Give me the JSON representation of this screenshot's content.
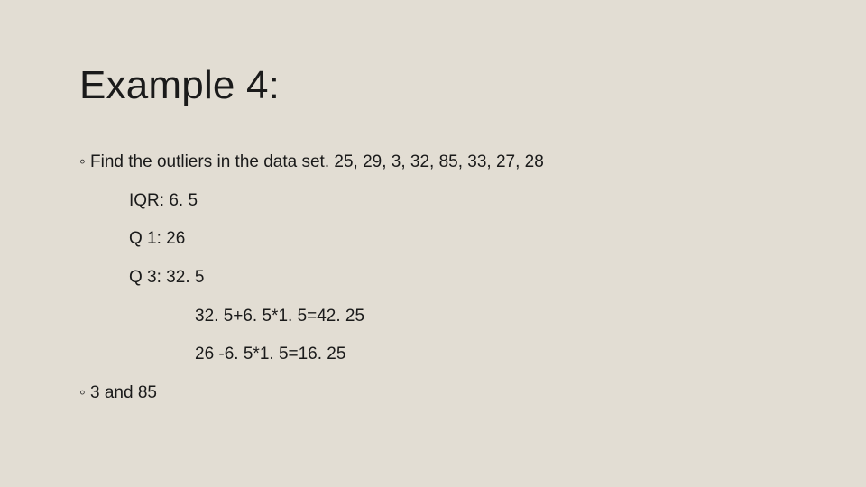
{
  "title": "Example 4:",
  "lines": {
    "b1": "◦ Find the outliers in the data set. 25, 29, 3, 32, 85, 33, 27, 28",
    "iqr": "IQR: 6. 5",
    "q1": "Q 1: 26",
    "q3": "Q 3: 32. 5",
    "upper": "32. 5+6. 5*1. 5=42. 25",
    "lower": "26 -6. 5*1. 5=16. 25",
    "b2": "◦ 3 and 85"
  }
}
